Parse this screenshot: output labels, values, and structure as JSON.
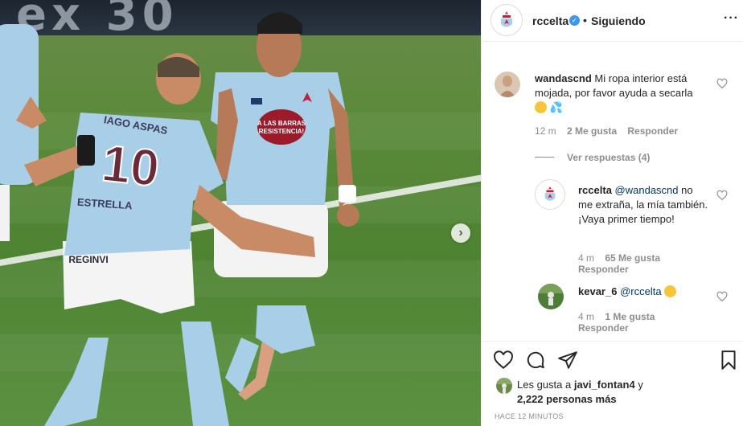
{
  "photo": {
    "banner_text": "ex  30",
    "player1_name": "IAGO ASPAS",
    "player1_number": "10",
    "sponsor": "ESTRELLA",
    "shorts_brand": "REGINVI",
    "player2_badge_line1": "A LAS BARRAS",
    "player2_badge_line2": "RESISTENCIA!",
    "next_icon": "chevron-right-icon"
  },
  "header": {
    "username": "rccelta",
    "verified_icon": "verified-badge-icon",
    "separator": "•",
    "follow_status": "Siguiendo",
    "more_icon": "ellipsis-icon",
    "more_label": "···"
  },
  "comments": [
    {
      "username": "wandascnd",
      "text": "Mi ropa interior está mojada, por favor ayuda a secarla",
      "emojis": [
        "kissing-face-emoji",
        "sweat-droplets-emoji"
      ],
      "time": "12 m",
      "likes": "2 Me gusta",
      "reply": "Responder",
      "view_replies": "Ver respuestas (4)"
    },
    {
      "username": "rccelta",
      "mention": "@wandascnd",
      "text": "no me extraña, la mía también. ¡Vaya primer tiempo!",
      "time": "4 m",
      "likes": "65 Me gusta",
      "reply": "Responder"
    },
    {
      "username": "kevar_6",
      "mention": "@rccelta",
      "emoji": "grinning-sweat-emoji",
      "time": "4 m",
      "likes": "1 Me gusta",
      "reply": "Responder"
    }
  ],
  "actions": {
    "like_icon": "heart-icon",
    "comment_icon": "comment-icon",
    "share_icon": "share-icon",
    "save_icon": "bookmark-icon"
  },
  "likes": {
    "prefix": "Les gusta a",
    "user": "javi_fontan4",
    "joiner": "y",
    "others": "2,222 personas más"
  },
  "timestamp": "HACE 12 MINUTOS",
  "colors": {
    "celta_blue": "#a9cfe8",
    "link_blue": "#00376b",
    "verified": "#3897f0",
    "meta_gray": "#8e8e8e",
    "pitch_green": "#5b9140"
  }
}
